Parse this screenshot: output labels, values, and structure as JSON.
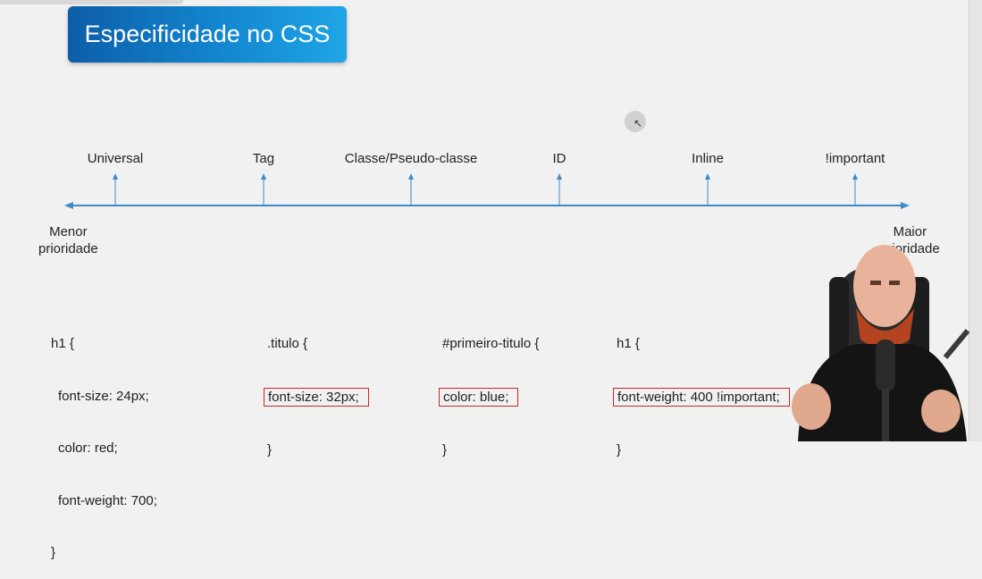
{
  "slide": {
    "title": "Especificidade no CSS"
  },
  "scale": {
    "levels": [
      "Universal",
      "Tag",
      "Classe/Pseudo-classe",
      "ID",
      "Inline",
      "!important"
    ],
    "low_end": [
      "Menor",
      "prioridade"
    ],
    "high_end": [
      "Maior",
      "prioridade"
    ]
  },
  "examples": [
    {
      "selector": "h1 {",
      "lines": [
        "font-size: 24px;",
        "color: red;",
        "font-weight: 700;"
      ],
      "close": "}"
    },
    {
      "selector": ".titulo {",
      "highlight": "font-size: 32px;",
      "close": "}"
    },
    {
      "selector": "#primeiro-titulo {",
      "highlight": "color: blue;",
      "close": "}"
    },
    {
      "selector": "h1 {",
      "highlight": "font-weight: 400 !important;",
      "close": "}"
    }
  ],
  "colors": {
    "title_gradient_start": "#0d5ea8",
    "title_gradient_end": "#1fa5e6",
    "axis": "#3d8ac7",
    "highlight_border": "#c62828"
  }
}
